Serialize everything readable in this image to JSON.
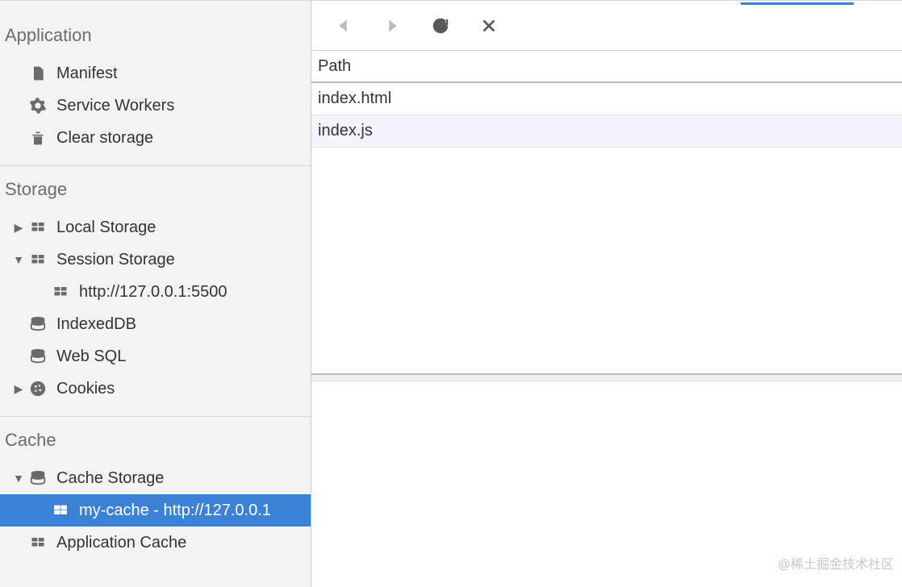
{
  "sidebar": {
    "sections": [
      {
        "title": "Application",
        "items": [
          {
            "label": "Manifest",
            "icon": "file-icon"
          },
          {
            "label": "Service Workers",
            "icon": "gear-icon"
          },
          {
            "label": "Clear storage",
            "icon": "trash-icon"
          }
        ]
      },
      {
        "title": "Storage",
        "items": [
          {
            "label": "Local Storage",
            "icon": "table-icon",
            "disclosure": "closed"
          },
          {
            "label": "Session Storage",
            "icon": "table-icon",
            "disclosure": "open",
            "children": [
              {
                "label": "http://127.0.0.1:5500",
                "icon": "table-icon"
              }
            ]
          },
          {
            "label": "IndexedDB",
            "icon": "database-icon"
          },
          {
            "label": "Web SQL",
            "icon": "database-icon"
          },
          {
            "label": "Cookies",
            "icon": "cookie-icon",
            "disclosure": "closed"
          }
        ]
      },
      {
        "title": "Cache",
        "items": [
          {
            "label": "Cache Storage",
            "icon": "database-icon",
            "disclosure": "open",
            "children": [
              {
                "label": "my-cache - http://127.0.0.1",
                "icon": "table-icon",
                "selected": true
              }
            ]
          },
          {
            "label": "Application Cache",
            "icon": "table-icon"
          }
        ]
      }
    ]
  },
  "main": {
    "toolbar": {
      "back": "Back",
      "forward": "Forward",
      "refresh": "Refresh",
      "close": "Close"
    },
    "table": {
      "header": "Path",
      "rows": [
        {
          "path": "index.html"
        },
        {
          "path": "index.js"
        }
      ]
    }
  },
  "watermark": "@稀土掘金技术社区"
}
